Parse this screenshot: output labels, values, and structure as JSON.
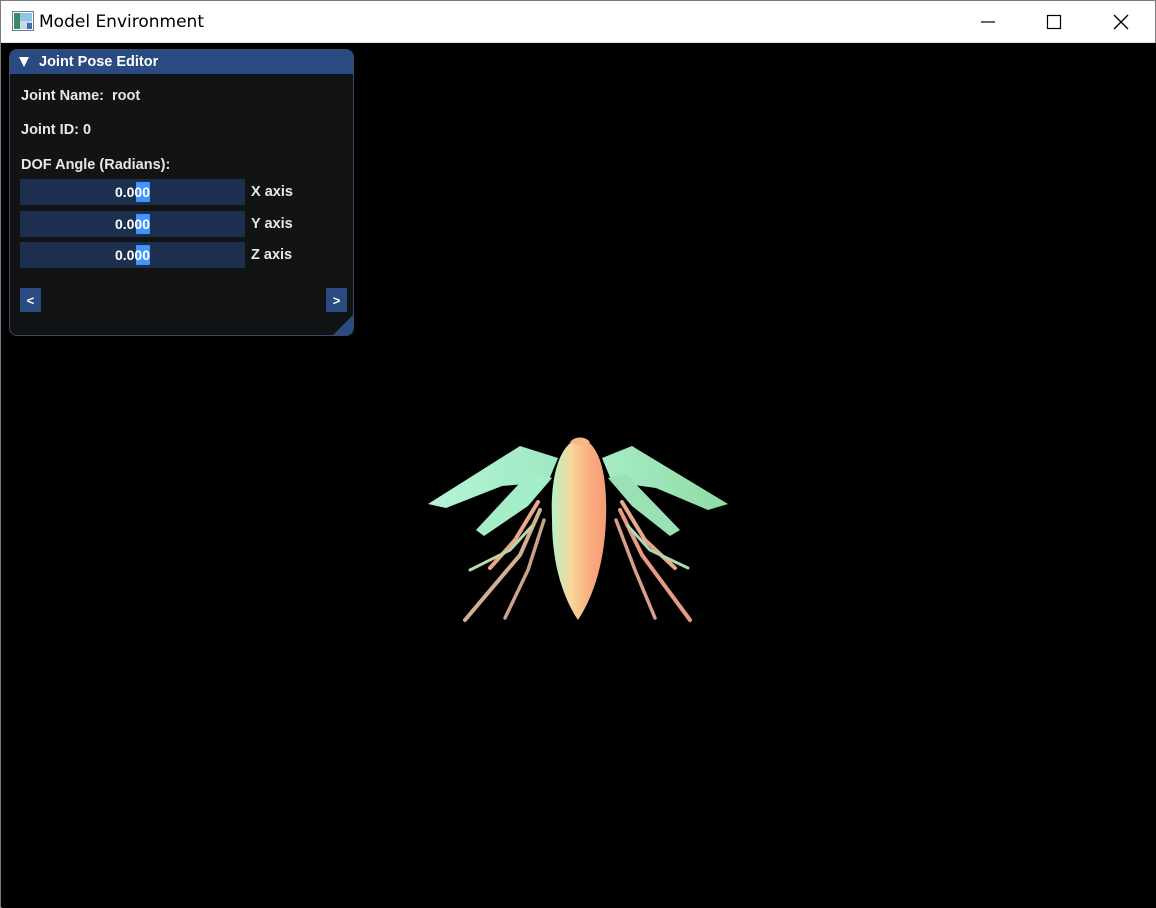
{
  "window": {
    "title": "Model Environment",
    "icon": "app-window-icon"
  },
  "titlebar_buttons": {
    "minimize": "minimize-icon",
    "maximize": "maximize-icon",
    "close": "close-icon"
  },
  "joint_pose_editor": {
    "title": "Joint Pose Editor",
    "joint_name_label": "Joint Name:",
    "joint_name_value": "root",
    "joint_id_text": "Joint ID: 0",
    "dof_label": "DOF Angle (Radians):",
    "sliders": [
      {
        "value": "0.000",
        "axis_label": "X axis"
      },
      {
        "value": "0.000",
        "axis_label": "Y axis"
      },
      {
        "value": "0.000",
        "axis_label": "Z axis"
      }
    ],
    "prev_button": "<",
    "next_button": ">"
  },
  "colors": {
    "panel_header": "#2a4b82",
    "slider_bg": "#1c2f4f",
    "slider_grab": "#4296fa",
    "body_peach": "#f7a57c",
    "wing_mint": "#a8f0cc"
  }
}
